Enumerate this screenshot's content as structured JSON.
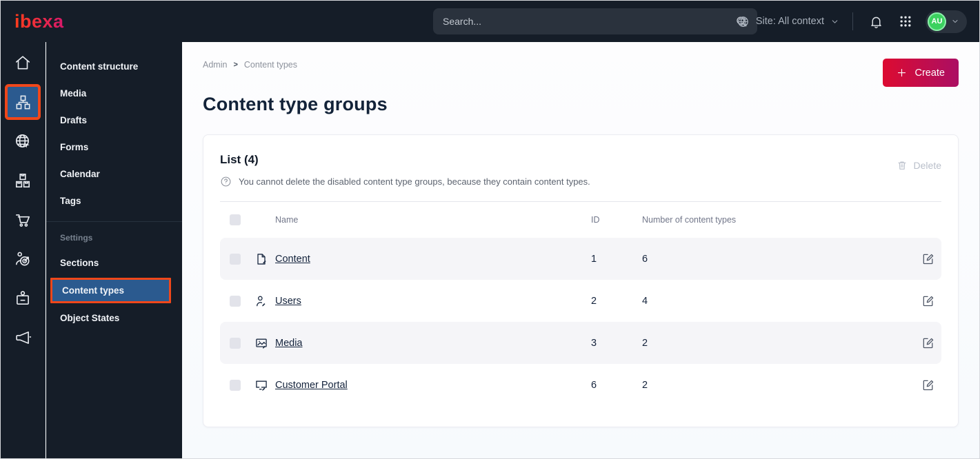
{
  "topbar": {
    "logo": "ibexa",
    "search_placeholder": "Search...",
    "site_label": "Site: All context",
    "avatar_initials": "AU"
  },
  "rail": {
    "items": [
      "home",
      "content-structure (active, annotated)",
      "site",
      "products",
      "commerce",
      "personalization",
      "admin",
      "marketing"
    ]
  },
  "sidebar": {
    "items": [
      "Content structure",
      "Media",
      "Drafts",
      "Forms",
      "Calendar",
      "Tags"
    ],
    "settings_label": "Settings",
    "settings_items": [
      "Sections",
      "Content types",
      "Object States"
    ],
    "active_item": "Content types"
  },
  "breadcrumb": {
    "items": [
      "Admin",
      "Content types"
    ],
    "separator": ">"
  },
  "page": {
    "title": "Content type groups",
    "create_label": "Create"
  },
  "panel": {
    "list_title": "List (4)",
    "info_text": "You cannot delete the disabled content type groups, because they contain content types.",
    "delete_label": "Delete"
  },
  "table": {
    "headers": {
      "name": "Name",
      "id": "ID",
      "count": "Number of content types"
    },
    "rows": [
      {
        "icon": "content-file-icon",
        "name": "Content",
        "id": "1",
        "count": "6"
      },
      {
        "icon": "users-person-icon",
        "name": "Users",
        "id": "2",
        "count": "4"
      },
      {
        "icon": "media-image-icon",
        "name": "Media",
        "id": "3",
        "count": "2"
      },
      {
        "icon": "customer-portal-monitor-icon",
        "name": "Customer Portal",
        "id": "6",
        "count": "2"
      }
    ]
  },
  "colors": {
    "topbar_bg": "#151d28",
    "active_blue": "#2b5a8f",
    "annotation_orange": "#f0471a",
    "brand_gradient_start": "#dc0b31",
    "brand_gradient_end": "#ab0f63",
    "avatar_green": "#3bd15f"
  }
}
